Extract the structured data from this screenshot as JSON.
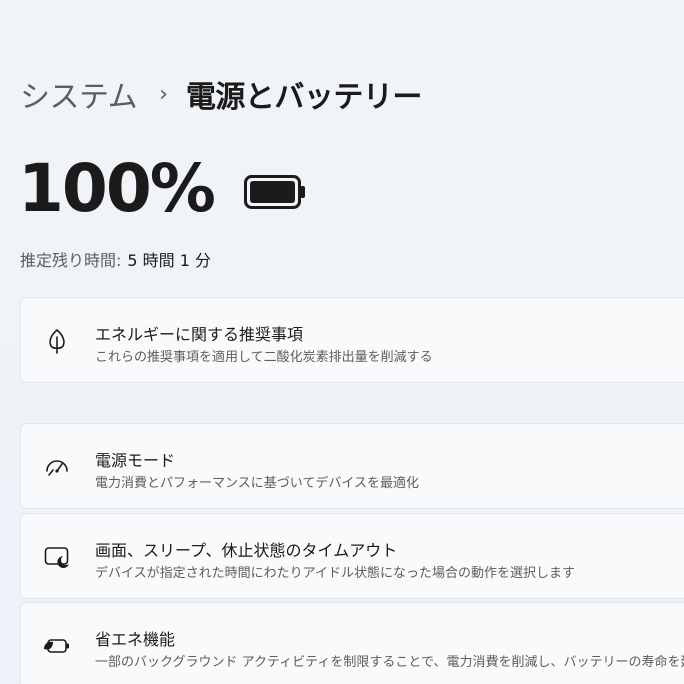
{
  "breadcrumb": {
    "parent": "システム",
    "separator": "›",
    "current": "電源とバッテリー"
  },
  "battery": {
    "percent_text": "100%",
    "level_percent": 100,
    "icon": "battery-full-icon"
  },
  "estimate": {
    "label": "推定残り時間:",
    "value": "5 時間 1 分"
  },
  "cards": [
    {
      "icon": "leaf-icon",
      "title": "エネルギーに関する推奨事項",
      "description": "これらの推奨事項を適用して二酸化炭素排出量を削減する"
    },
    {
      "icon": "power-mode-gauge-icon",
      "title": "電源モード",
      "description": "電力消費とパフォーマンスに基づいてデバイスを最適化"
    },
    {
      "icon": "screen-sleep-icon",
      "title": "画面、スリープ、休止状態のタイムアウト",
      "description": "デバイスが指定された時間にわたりアイドル状態になった場合の動作を選択します"
    },
    {
      "icon": "energy-saver-icon",
      "title": "省エネ機能",
      "description": "一部のバックグラウンド アクティビティを制限することで、電力消費を削減し、バッテリーの寿命を延ばす"
    }
  ],
  "colors": {
    "background": "#eef2f8",
    "card": "#f9fafc",
    "text_primary": "#1b1b1b",
    "text_secondary": "#5d5d5d"
  }
}
